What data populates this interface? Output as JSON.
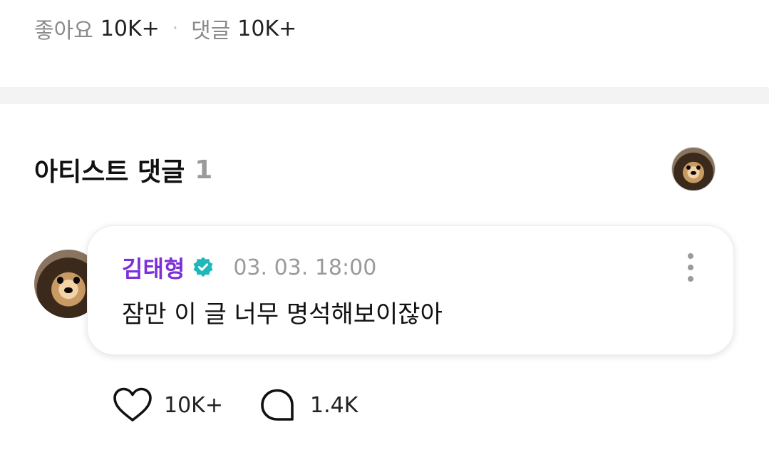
{
  "post_stats": {
    "likes_label": "좋아요",
    "likes_value": "10K+",
    "separator": "·",
    "comments_label": "댓글",
    "comments_value": "10K+"
  },
  "artist_comments": {
    "title": "아티스트 댓글",
    "count": "1"
  },
  "comment": {
    "author": "김태형",
    "verified": true,
    "timestamp": "03. 03. 18:00",
    "text": "잠만 이 글 너무 명석해보이잖아",
    "like_count": "10K+",
    "reply_count": "1.4K"
  },
  "colors": {
    "author": "#7d2fd8",
    "verified_badge": "#1fb8b8",
    "muted_text": "#9a9a9a",
    "divider": "#f3f3f3"
  },
  "icons": {
    "like": "heart-outline-icon",
    "reply": "speech-bubble-icon",
    "more": "vertical-dots-icon",
    "verified": "verified-badge-icon"
  }
}
